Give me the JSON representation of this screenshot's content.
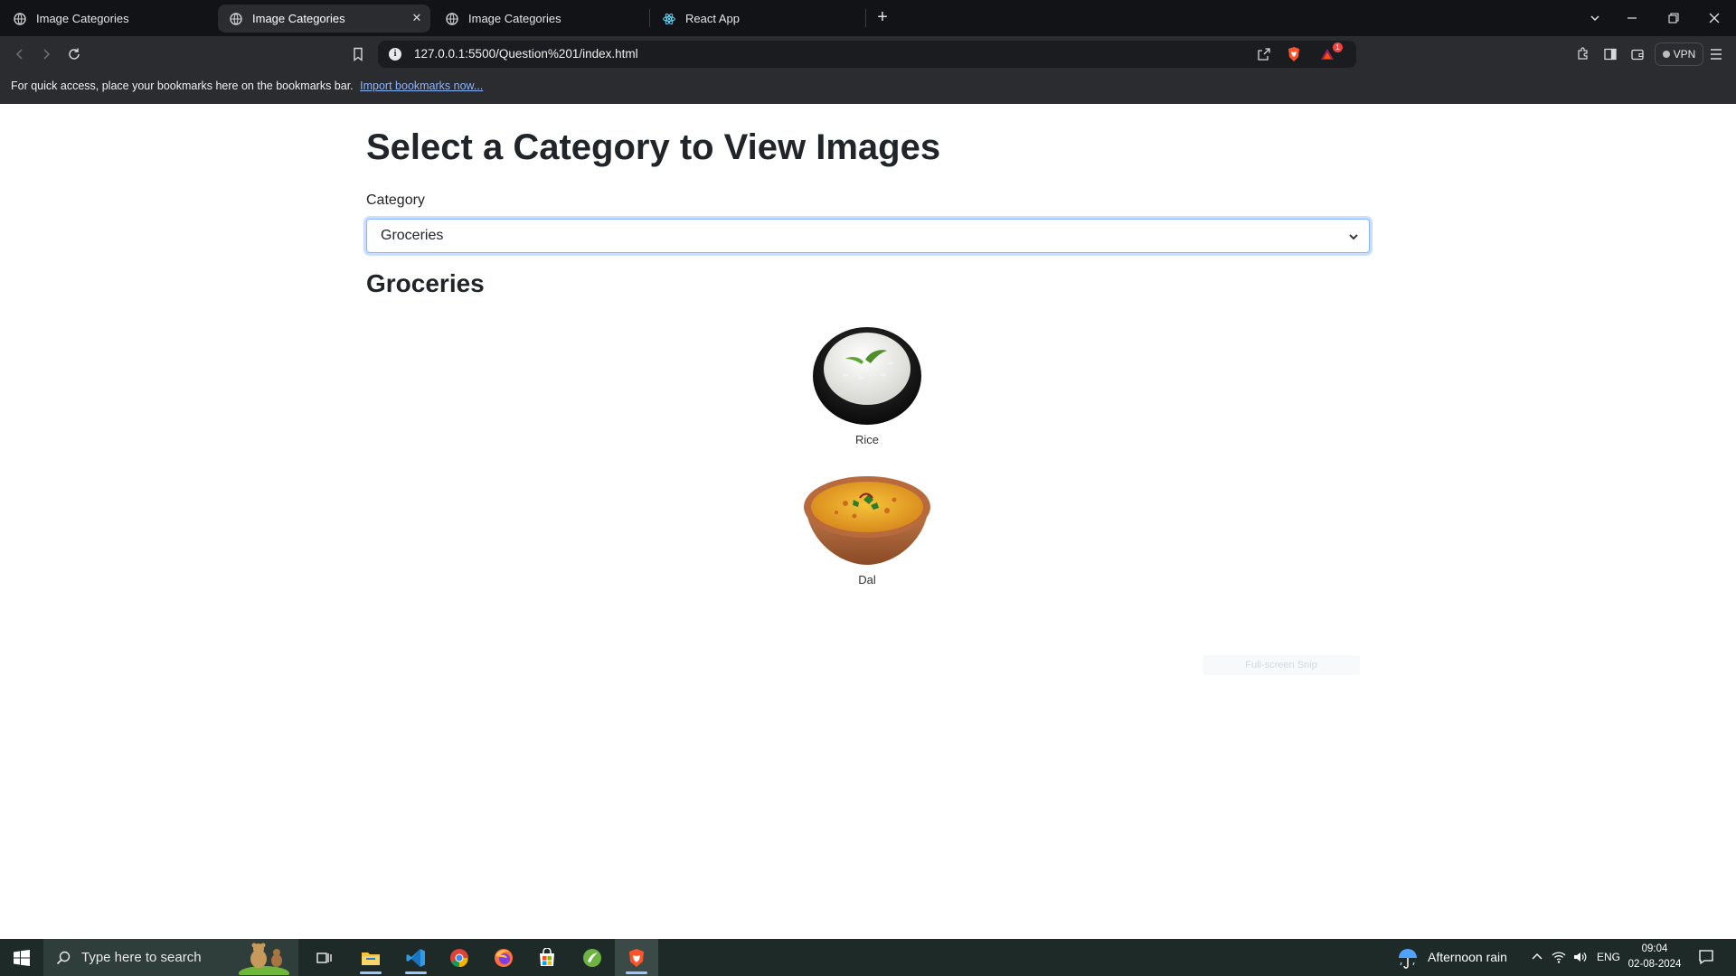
{
  "browser": {
    "tabs": [
      {
        "title": "Image Categories",
        "active": false
      },
      {
        "title": "Image Categories",
        "active": true
      },
      {
        "title": "Image Categories",
        "active": false
      },
      {
        "title": "React App",
        "active": false
      }
    ],
    "url": "127.0.0.1:5500/Question%201/index.html",
    "vpn_label": "VPN",
    "notification_count": "1",
    "bookmarks_bar": {
      "message": "For quick access, place your bookmarks here on the bookmarks bar.",
      "link": "Import bookmarks now..."
    }
  },
  "page": {
    "title": "Select a Category to View Images",
    "category_label": "Category",
    "selected_category": "Groceries",
    "section_title": "Groceries",
    "items": [
      {
        "label": "Rice",
        "icon": "rice-bowl-image"
      },
      {
        "label": "Dal",
        "icon": "dal-bowl-image"
      }
    ],
    "snip_overlay": "Full-screen Snip"
  },
  "taskbar": {
    "search_placeholder": "Type here to search",
    "weather": "Afternoon rain",
    "language": "ENG",
    "time": "09:04",
    "date": "02-08-2024"
  }
}
